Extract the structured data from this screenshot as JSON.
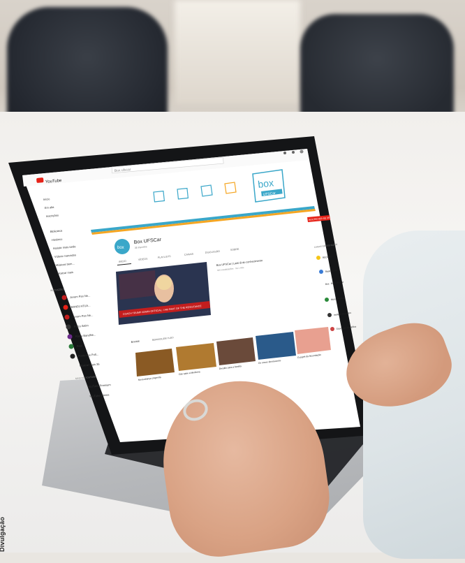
{
  "credit": "Divulgação",
  "youtube": {
    "logo_text": "YouTube",
    "search_placeholder": "Box ufscar",
    "sidebar": {
      "main": [
        "Início",
        "Em alta",
        "Inscrições"
      ],
      "library": [
        "Biblioteca",
        "Histórico",
        "Assistir mais tarde",
        "Vídeos marcados",
        "Músicas bem...",
        "Mostrar mais"
      ],
      "subscriptions_title": "INSCRIÇÕES",
      "subscriptions": [
        "Jovem Pan Ne...",
        "BANDJ ATUA...",
        "Jovem Pan Ne...",
        "Palco Itatim",
        "Rádio BandNe...",
        "Fast",
        "Ponto dos Polt..."
      ],
      "show_more": "Mostrar mais 36",
      "more_title": "MAIS DO YOUTUBE",
      "more": [
        "YouTube Premium",
        "YouTube Filmes"
      ]
    },
    "channel": {
      "name": "Box UFSCar",
      "subscribers": "35 inscritos",
      "avatar_text": "box",
      "banner_logo_main": "box",
      "banner_logo_sub": "UFSCar",
      "subscribe_label": "INSCREVER-SE 35",
      "tabs": [
        "INÍCIO",
        "VÍDEOS",
        "PLAYLISTS",
        "CANAIS",
        "DISCUSSÃO",
        "SOBRE"
      ],
      "featured_title": "Box UFSCar | Lado B do conhecimento",
      "featured_meta": "466 visualizações · há 1 mês",
      "featured_banner": "COACH TRUMP ADMIN OFFICIAL: I AM PART OF THE RESISTANCE",
      "row_title": "Envios",
      "row_play_all": "REPRODUZIR TUDO",
      "videos": [
        "Nova aliança | Agenda",
        "Cão sabe a Medicina",
        "Desafio para a família",
        "Os novos dinossauros",
        "O papel da fecundação"
      ],
      "right_panel_title": "CANAIS EM DESTAQUE",
      "right_panel": [
        "RECORD",
        "Rádio Nova",
        "Box · Box UFSCar",
        "Mundo Fútbol",
        "Instituto Brasileiro",
        "Educação Científica"
      ]
    }
  },
  "colors": {
    "youtube_red": "#e62117",
    "banner_teal": "#3aa7c9",
    "banner_orange": "#f5a623",
    "screen_bezel": "#141517"
  }
}
